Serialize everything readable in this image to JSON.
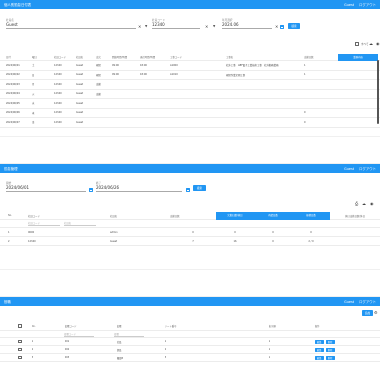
{
  "panel1": {
    "title": "個人別勤怠日付表",
    "user": "Guest",
    "logout": "ログアウト",
    "user_label": "社員名",
    "user_value": "Guest",
    "code_label": "社員コード",
    "code_value": "12340",
    "month_label": "年月選択",
    "month_value": "2024.06",
    "search_button": "検索",
    "all_label": "すべて",
    "headers": [
      "日付",
      "曜日",
      "社員コード",
      "社員名",
      "出欠",
      "開始時間/時間",
      "退社時間/時間",
      "工事コード",
      "工事名",
      "出勤日数",
      "業務内容"
    ],
    "rows": [
      [
        "2024/06/01",
        "土",
        "12340",
        "Guest",
        "現場",
        "09:00",
        "18:00",
        "A1000",
        "社外工事　ABF電子工業技術工事　社外勤務業務",
        "1",
        ""
      ],
      [
        "2024/06/02",
        "日",
        "12340",
        "Guest",
        "現場",
        "09:00",
        "18:00",
        "A1010",
        "現場作業定期工事",
        "1",
        ""
      ],
      [
        "2024/06/03",
        "月",
        "12340",
        "Guest",
        "出勤",
        "",
        "",
        "",
        "",
        "",
        ""
      ],
      [
        "2024/06/04",
        "火",
        "12340",
        "Guest",
        "出勤",
        "",
        "",
        "",
        "",
        "",
        ""
      ],
      [
        "2024/06/05",
        "水",
        "12340",
        "Guest",
        "",
        "",
        "",
        "",
        "",
        "",
        ""
      ],
      [
        "2024/06/06",
        "木",
        "12340",
        "Guest",
        "",
        "",
        "",
        "",
        "",
        "0",
        ""
      ],
      [
        "2024/06/07",
        "金",
        "12340",
        "Guest",
        "",
        "",
        "",
        "",
        "",
        "0",
        ""
      ]
    ]
  },
  "panel2": {
    "title": "勤怠管理",
    "user": "Guest",
    "logout": "ログアウト",
    "from_label": "開始",
    "from_value": "2024/06/01",
    "to_label": "終了",
    "to_value": "2024/06/26",
    "search_button": "検索",
    "headers": [
      "No.",
      "社員コード",
      "社員名",
      "出勤日数",
      "欠勤日数/休日",
      "有給日数",
      "振替日数",
      "休日出勤日数/休日"
    ],
    "filter_code": "社員コード",
    "filter_name": "社員名",
    "rows": [
      [
        "1",
        "0000",
        "admin",
        "0",
        "0",
        "0",
        "0"
      ],
      [
        "2",
        "12340",
        "Guest",
        "7",
        "16",
        "0",
        "2 / 0"
      ]
    ]
  },
  "panel3": {
    "title": "役職",
    "user": "Guest",
    "logout": "ログアウト",
    "add_button": "追加",
    "headers": [
      "No.",
      "役職コード",
      "役職",
      "ソート番号",
      "表示順",
      "操作"
    ],
    "filter_code": "役職コード",
    "filter_name": "役職",
    "edit_label": "編集",
    "delete_label": "削除",
    "rows": [
      [
        "1",
        "001",
        "社長",
        "1",
        "1"
      ],
      [
        "2",
        "002",
        "部長",
        "2",
        "1"
      ],
      [
        "3",
        "003",
        "課長B",
        "3",
        "1"
      ]
    ]
  }
}
